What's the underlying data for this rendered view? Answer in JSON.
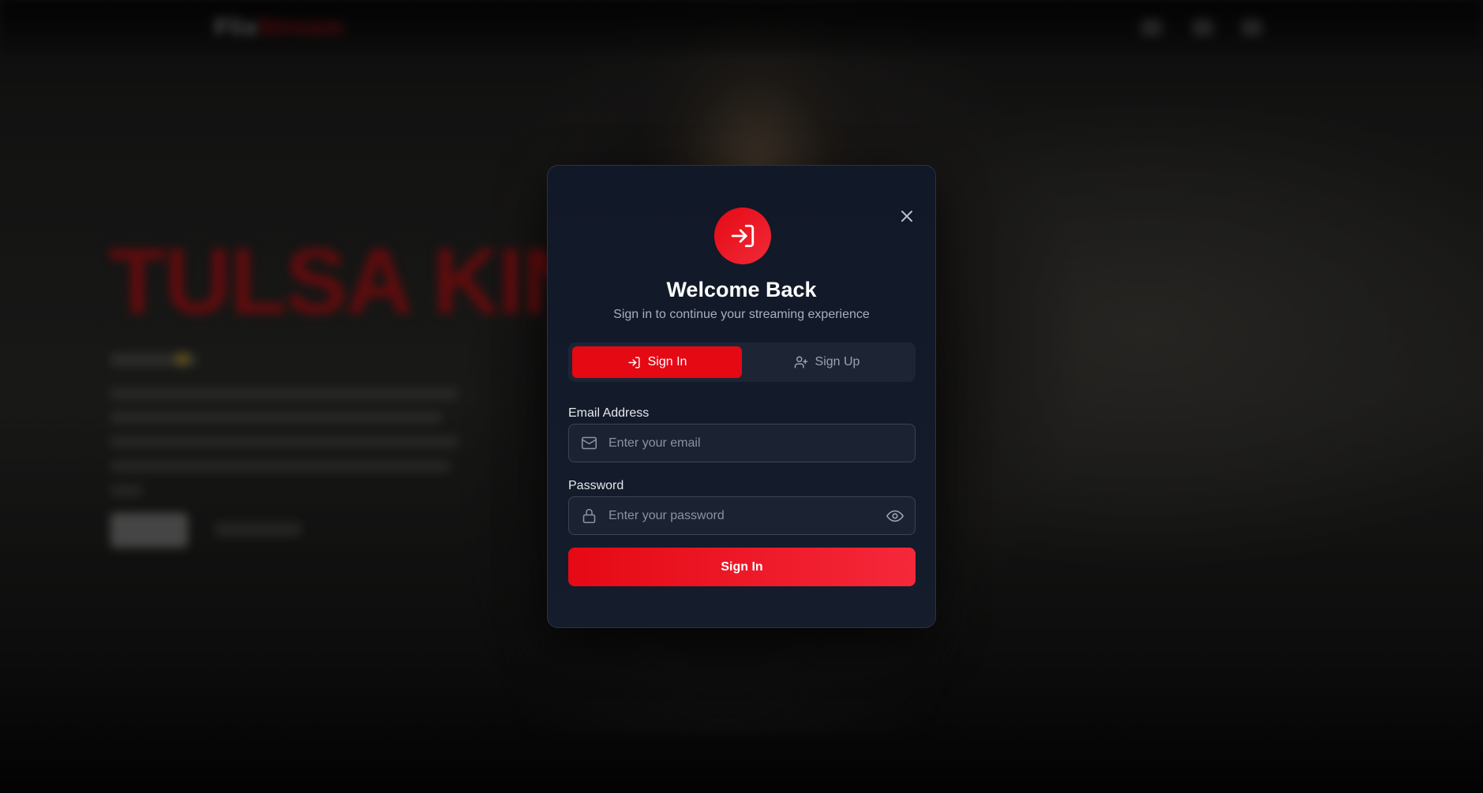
{
  "background": {
    "logo_primary": "Flix",
    "logo_accent": "Stream",
    "hero_title": "TULSA KING"
  },
  "modal": {
    "title": "Welcome Back",
    "subtitle": "Sign in to continue your streaming experience",
    "header_icon": "sign-in-icon",
    "close_icon": "close-icon",
    "accent_color": "#e50914",
    "tabs": [
      {
        "label": "Sign In",
        "icon": "sign-in-icon",
        "active": true
      },
      {
        "label": "Sign Up",
        "icon": "user-plus-icon",
        "active": false
      }
    ],
    "email": {
      "label": "Email Address",
      "placeholder": "Enter your email",
      "value": "",
      "icon": "mail-icon"
    },
    "password": {
      "label": "Password",
      "placeholder": "Enter your password",
      "value": "",
      "icon": "lock-icon",
      "toggle_icon": "eye-icon"
    },
    "submit_label": "Sign In"
  }
}
